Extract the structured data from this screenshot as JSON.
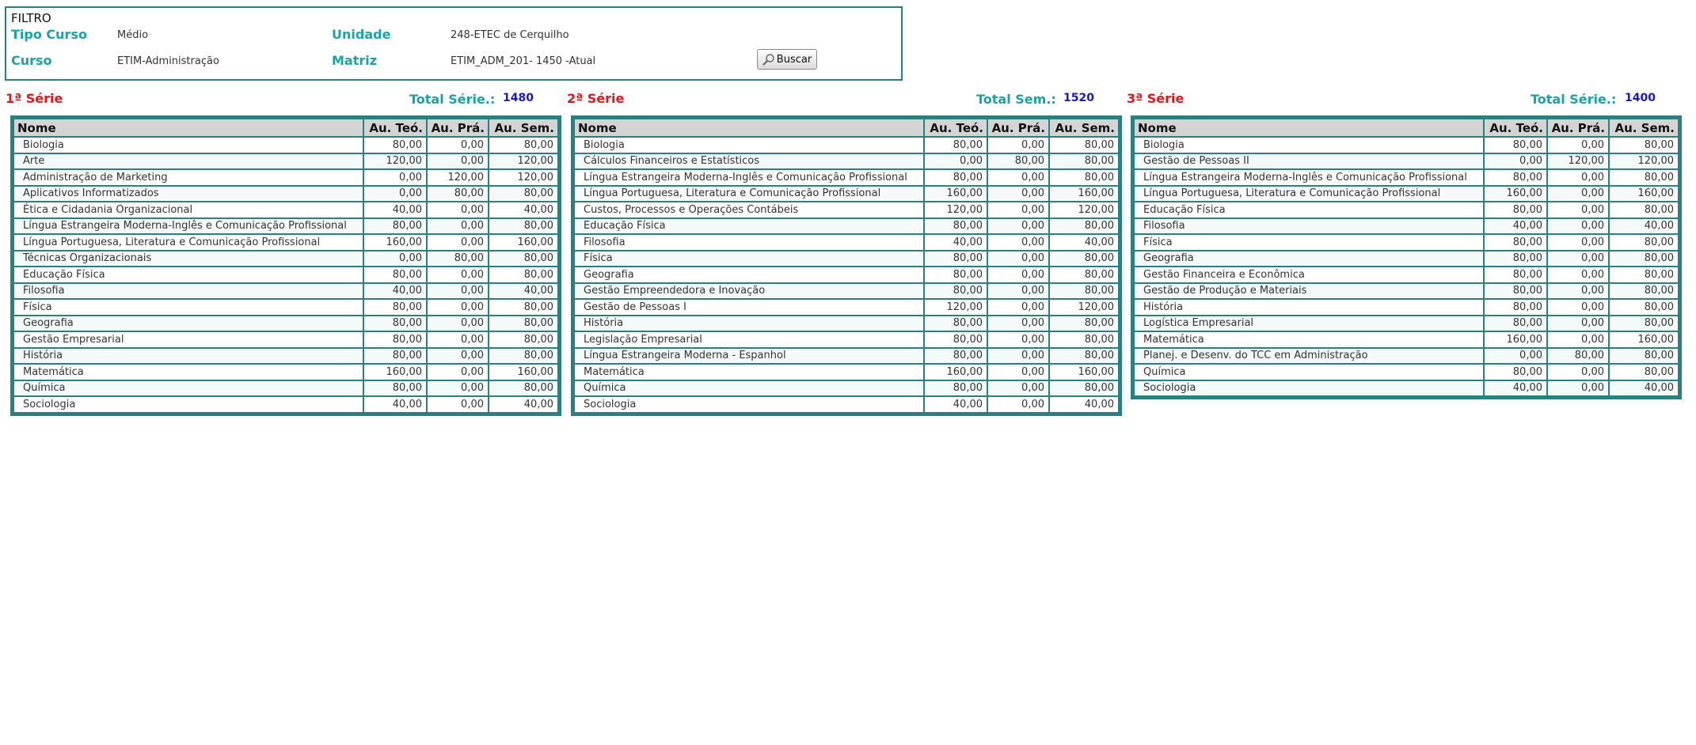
{
  "filter": {
    "title": "FILTRO",
    "tipo_curso_label": "Tipo Curso",
    "tipo_curso_value": "Médio",
    "unidade_label": "Unidade",
    "unidade_value": "248-ETEC de Cerquilho",
    "curso_label": "Curso",
    "curso_value": "ETIM-Administração",
    "matriz_label": "Matriz",
    "matriz_value": "ETIM_ADM_201- 1450 -Atual",
    "buscar_label": "Buscar",
    "buscar_icon": "magnifier-icon"
  },
  "columns": [
    "Nome",
    "Au. Teó.",
    "Au. Prá.",
    "Au. Sem."
  ],
  "series": [
    {
      "title": "1ª Série",
      "total_label": "Total Série.:",
      "total_value": "1480",
      "rows": [
        [
          "Biologia",
          "80,00",
          "0,00",
          "80,00"
        ],
        [
          "Arte",
          "120,00",
          "0,00",
          "120,00"
        ],
        [
          "Administração de Marketing",
          "0,00",
          "120,00",
          "120,00"
        ],
        [
          "Aplicativos Informatizados",
          "0,00",
          "80,00",
          "80,00"
        ],
        [
          "Ética e Cidadania Organizacional",
          "40,00",
          "0,00",
          "40,00"
        ],
        [
          "Língua Estrangeira Moderna-Inglês e Comunicação Profissional",
          "80,00",
          "0,00",
          "80,00"
        ],
        [
          "Língua Portuguesa, Literatura e Comunicação Profissional",
          "160,00",
          "0,00",
          "160,00"
        ],
        [
          "Técnicas Organizacionais",
          "0,00",
          "80,00",
          "80,00"
        ],
        [
          "Educação Física",
          "80,00",
          "0,00",
          "80,00"
        ],
        [
          "Filosofia",
          "40,00",
          "0,00",
          "40,00"
        ],
        [
          "Física",
          "80,00",
          "0,00",
          "80,00"
        ],
        [
          "Geografia",
          "80,00",
          "0,00",
          "80,00"
        ],
        [
          "Gestão Empresarial",
          "80,00",
          "0,00",
          "80,00"
        ],
        [
          "História",
          "80,00",
          "0,00",
          "80,00"
        ],
        [
          "Matemática",
          "160,00",
          "0,00",
          "160,00"
        ],
        [
          "Química",
          "80,00",
          "0,00",
          "80,00"
        ],
        [
          "Sociologia",
          "40,00",
          "0,00",
          "40,00"
        ]
      ]
    },
    {
      "title": "2ª Série",
      "total_label": "Total Sem.:",
      "total_value": "1520",
      "rows": [
        [
          "Biologia",
          "80,00",
          "0,00",
          "80,00"
        ],
        [
          "Cálculos Financeiros e Estatísticos",
          "0,00",
          "80,00",
          "80,00"
        ],
        [
          "Língua Estrangeira Moderna-Inglês e Comunicação Profissional",
          "80,00",
          "0,00",
          "80,00"
        ],
        [
          "Língua Portuguesa, Literatura e Comunicação Profissional",
          "160,00",
          "0,00",
          "160,00"
        ],
        [
          "Custos, Processos e Operações Contábeis",
          "120,00",
          "0,00",
          "120,00"
        ],
        [
          "Educação Física",
          "80,00",
          "0,00",
          "80,00"
        ],
        [
          "Filosofia",
          "40,00",
          "0,00",
          "40,00"
        ],
        [
          "Física",
          "80,00",
          "0,00",
          "80,00"
        ],
        [
          "Geografia",
          "80,00",
          "0,00",
          "80,00"
        ],
        [
          "Gestão Empreendedora e Inovação",
          "80,00",
          "0,00",
          "80,00"
        ],
        [
          "Gestão de Pessoas I",
          "120,00",
          "0,00",
          "120,00"
        ],
        [
          "História",
          "80,00",
          "0,00",
          "80,00"
        ],
        [
          "Legislação Empresarial",
          "80,00",
          "0,00",
          "80,00"
        ],
        [
          "Língua Estrangeira Moderna - Espanhol",
          "80,00",
          "0,00",
          "80,00"
        ],
        [
          "Matemática",
          "160,00",
          "0,00",
          "160,00"
        ],
        [
          "Química",
          "80,00",
          "0,00",
          "80,00"
        ],
        [
          "Sociologia",
          "40,00",
          "0,00",
          "40,00"
        ]
      ]
    },
    {
      "title": "3ª Série",
      "total_label": "Total Série.:",
      "total_value": "1400",
      "rows": [
        [
          "Biologia",
          "80,00",
          "0,00",
          "80,00"
        ],
        [
          "Gestão de Pessoas II",
          "0,00",
          "120,00",
          "120,00"
        ],
        [
          "Língua Estrangeira Moderna-Inglês e Comunicação Profissional",
          "80,00",
          "0,00",
          "80,00"
        ],
        [
          "Língua Portuguesa, Literatura e Comunicação Profissional",
          "160,00",
          "0,00",
          "160,00"
        ],
        [
          "Educação Física",
          "80,00",
          "0,00",
          "80,00"
        ],
        [
          "Filosofia",
          "40,00",
          "0,00",
          "40,00"
        ],
        [
          "Física",
          "80,00",
          "0,00",
          "80,00"
        ],
        [
          "Geografia",
          "80,00",
          "0,00",
          "80,00"
        ],
        [
          "Gestão Financeira e Econômica",
          "80,00",
          "0,00",
          "80,00"
        ],
        [
          "Gestão de Produção e Materiais",
          "80,00",
          "0,00",
          "80,00"
        ],
        [
          "História",
          "80,00",
          "0,00",
          "80,00"
        ],
        [
          "Logística Empresarial",
          "80,00",
          "0,00",
          "80,00"
        ],
        [
          "Matemática",
          "160,00",
          "0,00",
          "160,00"
        ],
        [
          "Planej. e Desenv. do TCC em Administração",
          "0,00",
          "80,00",
          "80,00"
        ],
        [
          "Química",
          "80,00",
          "0,00",
          "80,00"
        ],
        [
          "Sociologia",
          "40,00",
          "0,00",
          "40,00"
        ]
      ]
    }
  ],
  "colors": {
    "accent_teal": "#1aa3a3",
    "border_teal": "#2a7f7f",
    "series_red": "#e0161e",
    "total_blue": "#1818c8"
  }
}
